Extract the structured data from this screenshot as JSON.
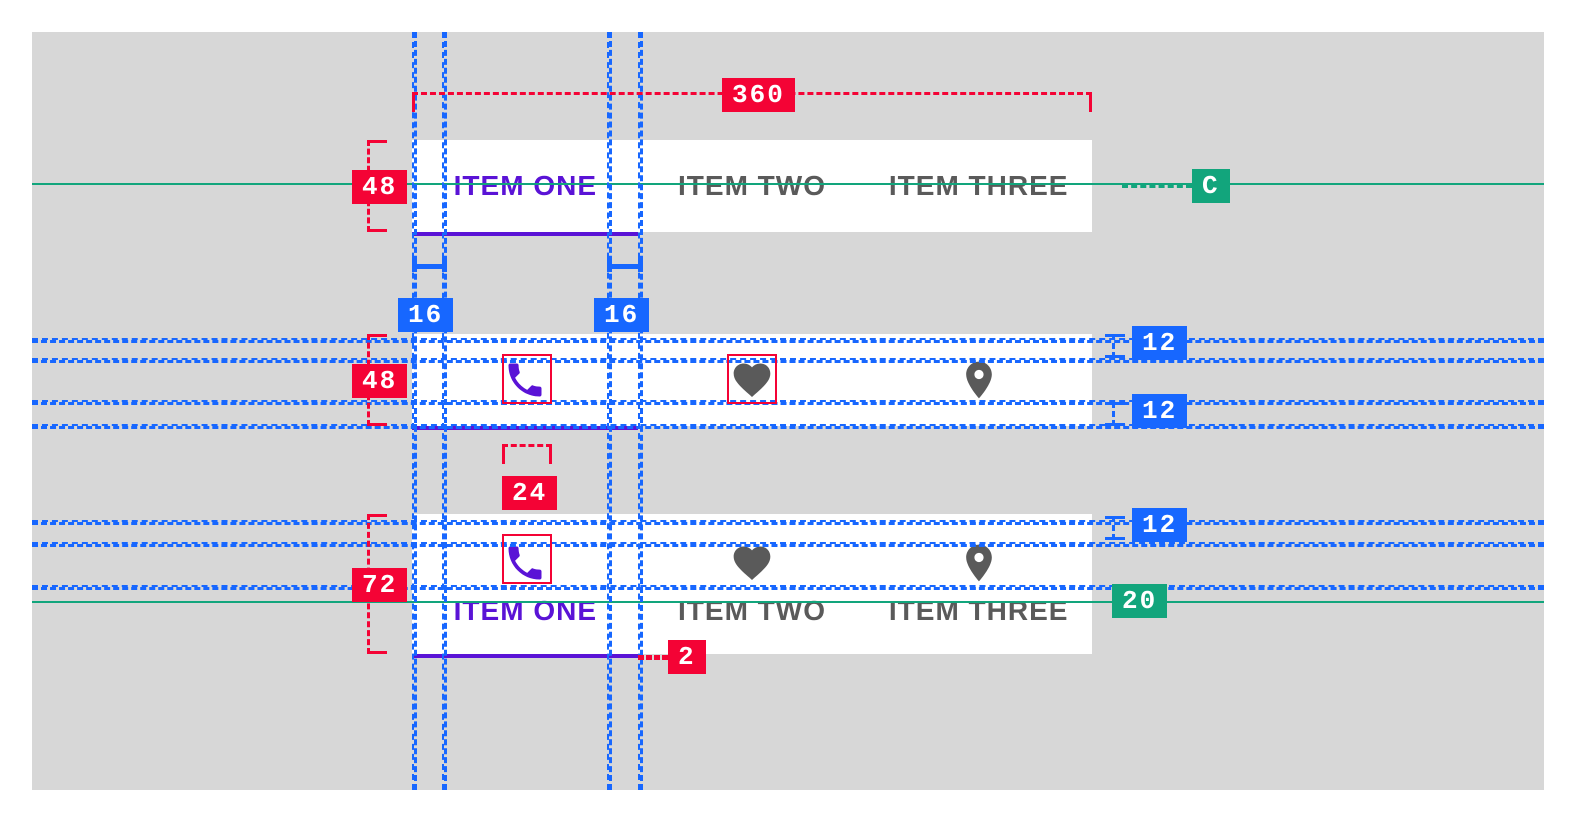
{
  "tabs": {
    "item1": "ITEM ONE",
    "item2": "ITEM TWO",
    "item3": "ITEM THREE"
  },
  "icons": {
    "phone": "phone-icon",
    "heart": "heart-icon",
    "pin": "location-pin-icon"
  },
  "measurements": {
    "width_total": "360",
    "height_text_tab": "48",
    "height_icon_tab": "48",
    "height_combo_tab": "72",
    "padding_left": "16",
    "padding_right": "16",
    "icon_size": "24",
    "icon_top_pad": "12",
    "icon_bottom_pad": "12",
    "combo_top_pad": "12",
    "combo_text_pad": "20",
    "indicator_thickness": "2",
    "centerline": "C"
  },
  "colors": {
    "active": "#5a13d6",
    "inactive": "#5a5a5a",
    "measure_red": "#f40335",
    "measure_blue": "#1767ff",
    "measure_green": "#12a57c"
  }
}
